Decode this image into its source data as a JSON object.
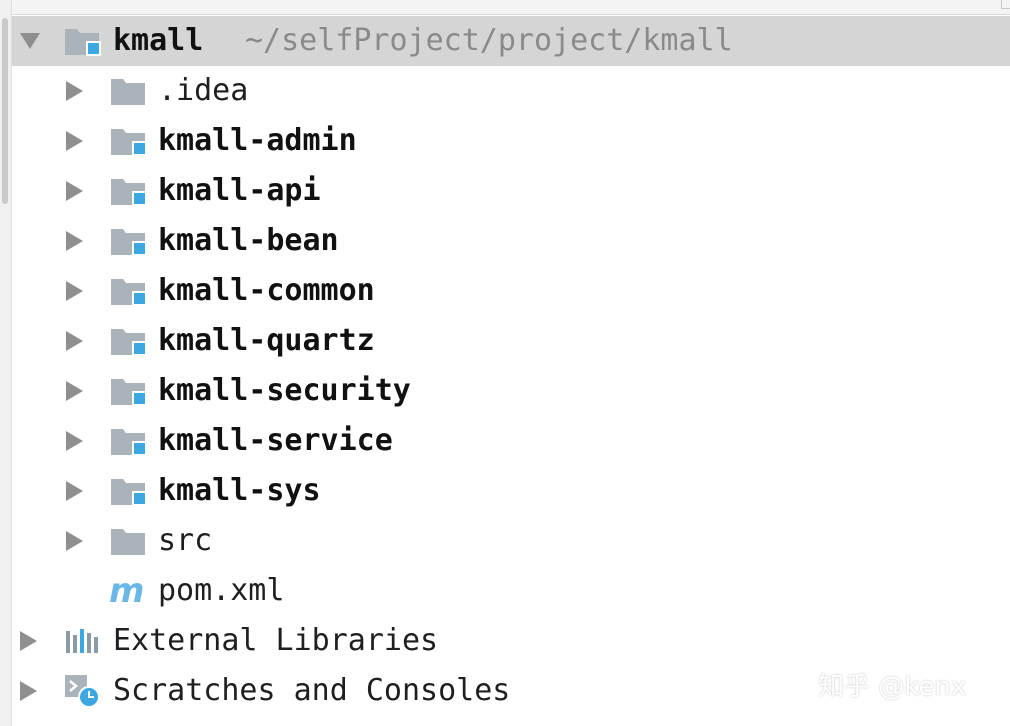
{
  "colors": {
    "selection_bg": "#d5d5d5",
    "folder_gray": "#aab2ba",
    "module_accent": "#3da7e2",
    "path_text": "#8a8a8a",
    "maven_blue": "#6bb8e8"
  },
  "project": {
    "name": "kmall",
    "path": "~/selfProject/project/kmall",
    "icon": "module-folder-icon",
    "expanded": true
  },
  "children": [
    {
      "label": ".idea",
      "icon": "folder-icon",
      "bold": false
    },
    {
      "label": "kmall-admin",
      "icon": "module-folder-icon",
      "bold": true
    },
    {
      "label": "kmall-api",
      "icon": "module-folder-icon",
      "bold": true
    },
    {
      "label": "kmall-bean",
      "icon": "module-folder-icon",
      "bold": true
    },
    {
      "label": "kmall-common",
      "icon": "module-folder-icon",
      "bold": true
    },
    {
      "label": "kmall-quartz",
      "icon": "module-folder-icon",
      "bold": true
    },
    {
      "label": "kmall-security",
      "icon": "module-folder-icon",
      "bold": true
    },
    {
      "label": "kmall-service",
      "icon": "module-folder-icon",
      "bold": true
    },
    {
      "label": "kmall-sys",
      "icon": "module-folder-icon",
      "bold": true
    },
    {
      "label": "src",
      "icon": "folder-icon",
      "bold": false
    },
    {
      "label": "pom.xml",
      "icon": "maven-file-icon",
      "bold": false
    }
  ],
  "roots": [
    {
      "label": "External Libraries",
      "icon": "external-libraries-icon"
    },
    {
      "label": "Scratches and Consoles",
      "icon": "scratches-icon"
    }
  ],
  "watermark": "知乎 @kenx"
}
